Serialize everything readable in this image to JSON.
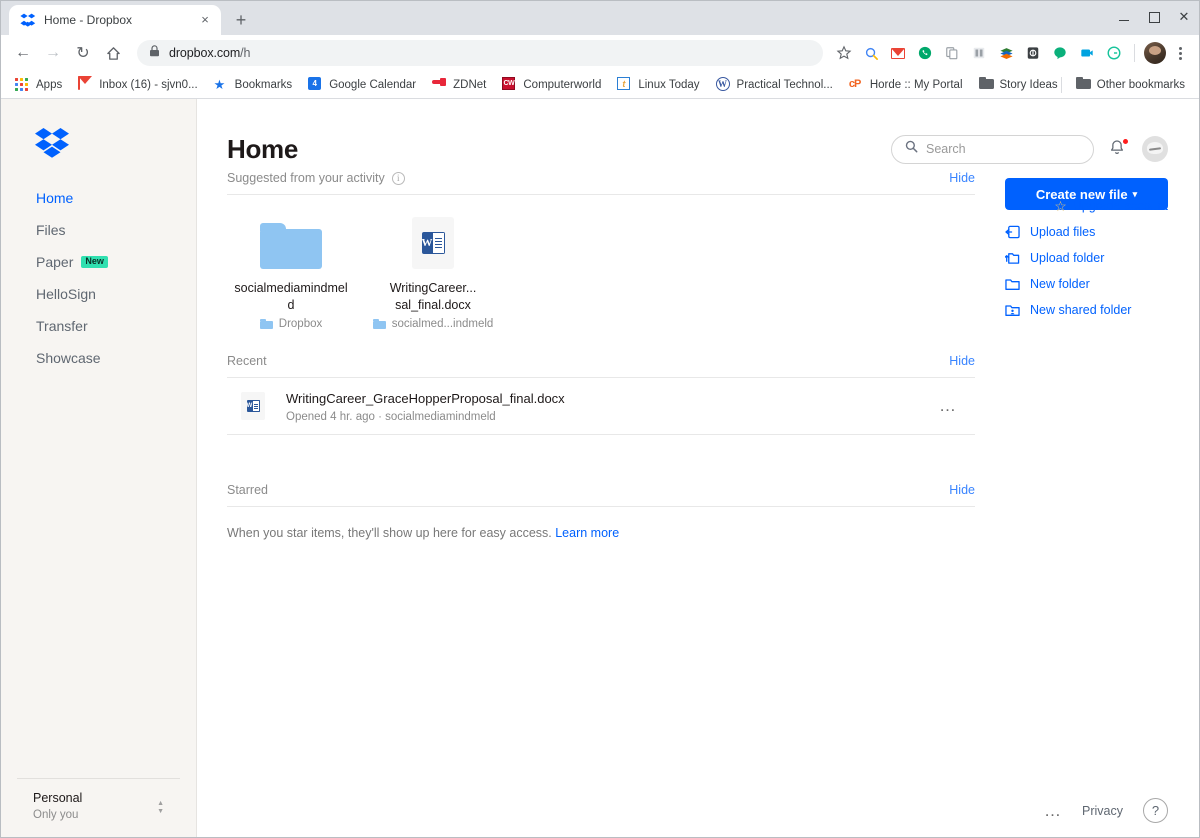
{
  "browser": {
    "tab": {
      "title": "Home - Dropbox",
      "favicon": "dropbox-icon",
      "close_label": "×"
    },
    "new_tab_label": "+",
    "window_controls": {
      "minimize": "minimize-icon",
      "maximize": "maximize-icon",
      "close": "✕"
    },
    "nav": {
      "back": "←",
      "forward": "→",
      "reload": "↻",
      "home": "⌂"
    },
    "omnibox": {
      "lock": "🔒",
      "domain": "dropbox.com",
      "path": "/h"
    },
    "toolbar_icons": [
      {
        "name": "star-bookmark-icon",
        "glyph": "☆",
        "color": "#5f6368"
      },
      {
        "name": "magnifier-extension-icon",
        "glyph": "🔍",
        "color": "#5f6368"
      },
      {
        "name": "gmail-extension-icon",
        "glyph": "M",
        "color": "#ea4335"
      },
      {
        "name": "phone-extension-icon",
        "glyph": "✆",
        "color": "#00a86b"
      },
      {
        "name": "copy-extension-icon",
        "glyph": "⧉",
        "color": "#9aa0a6"
      },
      {
        "name": "grammar-extension-icon",
        "glyph": "☷",
        "color": "#9aa0a6"
      },
      {
        "name": "books-extension-icon",
        "glyph": "📚",
        "color": "#2e7d32"
      },
      {
        "name": "shield-extension-icon",
        "glyph": "◎",
        "color": "#3c4043"
      },
      {
        "name": "chat-extension-icon",
        "glyph": "●",
        "color": "#0bb07b"
      },
      {
        "name": "meet-extension-icon",
        "glyph": "■",
        "color": "#00a3e0"
      },
      {
        "name": "grammarly-extension-icon",
        "glyph": "G",
        "color": "#15c39a"
      }
    ],
    "bookmarks": [
      {
        "label": "Apps",
        "icon": "apps-grid-icon"
      },
      {
        "label": "Inbox (16) - sjvn0...",
        "icon": "gmail-icon"
      },
      {
        "label": "Bookmarks",
        "icon": "star-icon"
      },
      {
        "label": "Google Calendar",
        "icon": "calendar-icon"
      },
      {
        "label": "ZDNet",
        "icon": "zdnet-icon"
      },
      {
        "label": "Computerworld",
        "icon": "computerworld-icon"
      },
      {
        "label": "Linux Today",
        "icon": "linuxtoday-icon"
      },
      {
        "label": "Practical Technol...",
        "icon": "wordpress-icon"
      },
      {
        "label": "Horde :: My Portal",
        "icon": "horde-icon"
      },
      {
        "label": "Story Ideas",
        "icon": "folder-icon"
      }
    ],
    "other_bookmarks": {
      "label": "Other bookmarks",
      "icon": "folder-icon"
    }
  },
  "sidebar": {
    "logo": "dropbox-logo",
    "items": [
      {
        "label": "Home",
        "active": true
      },
      {
        "label": "Files",
        "active": false
      },
      {
        "label": "Paper",
        "active": false,
        "badge": "New"
      },
      {
        "label": "HelloSign",
        "active": false
      },
      {
        "label": "Transfer",
        "active": false
      },
      {
        "label": "Showcase",
        "active": false
      }
    ],
    "account": {
      "name": "Personal",
      "subtitle": "Only you"
    }
  },
  "header": {
    "upgrade": {
      "label": "Upgrade account",
      "icon": "star-outline-icon"
    },
    "title": "Home",
    "search": {
      "placeholder": "Search",
      "icon": "search-icon"
    },
    "notifications": {
      "icon": "bell-icon",
      "has_badge": true
    },
    "avatar": "user-avatar"
  },
  "suggested": {
    "heading": "Suggested from your activity",
    "info_icon": "info-icon",
    "hide_label": "Hide",
    "tiles": [
      {
        "name": "socialmediamindmeld",
        "location": "Dropbox",
        "kind": "folder"
      },
      {
        "name": "WritingCareer...sal_final.docx",
        "name_line1": "WritingCareer...",
        "name_line2": "sal_final.docx",
        "location": "socialmed...indmeld",
        "kind": "word-document"
      }
    ]
  },
  "recent": {
    "heading": "Recent",
    "hide_label": "Hide",
    "items": [
      {
        "name": "WritingCareer_GraceHopperProposal_final.docx",
        "meta": "Opened 4 hr. ago · socialmediamindmeld",
        "kind": "word-document",
        "menu": "…"
      }
    ]
  },
  "starred": {
    "heading": "Starred",
    "hide_label": "Hide",
    "empty_text": "When you star items, they'll show up here for easy access.",
    "learn_more": "Learn more"
  },
  "actions": {
    "create_button": {
      "label": "Create new file",
      "caret": "▾"
    },
    "items": [
      {
        "label": "Upload files",
        "icon": "upload-file-icon"
      },
      {
        "label": "Upload folder",
        "icon": "upload-folder-icon"
      },
      {
        "label": "New folder",
        "icon": "new-folder-icon"
      },
      {
        "label": "New shared folder",
        "icon": "new-shared-folder-icon"
      }
    ]
  },
  "footer": {
    "more": "…",
    "privacy": "Privacy",
    "help": "?"
  },
  "colors": {
    "dropbox_blue": "#0061fe",
    "link_blue": "#3984ff",
    "badge_green": "#30e0b0",
    "sidebar_bg": "#f7f5f2",
    "notification_red": "#ff1c1c"
  }
}
